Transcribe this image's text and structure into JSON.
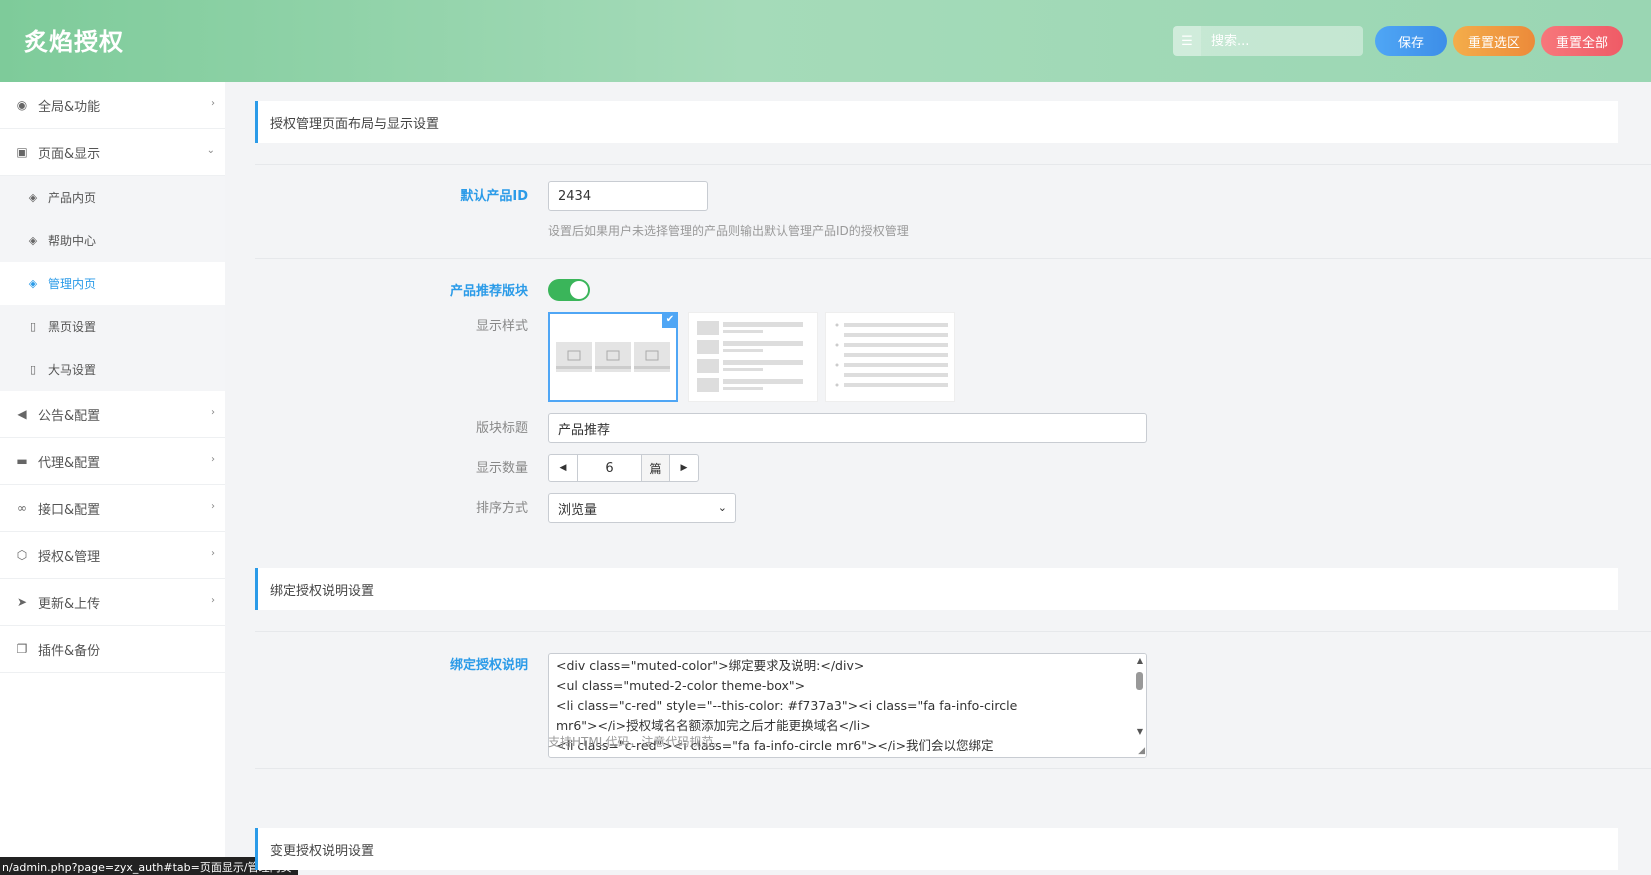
{
  "header": {
    "brand": "炙焰授权",
    "search_placeholder": "搜索...",
    "buttons": {
      "save": "保存",
      "reset_section": "重置选区",
      "reset_all": "重置全部"
    }
  },
  "sidebar": {
    "items": [
      {
        "label": "全局&功能",
        "icon": "circle-dot-icon",
        "arrow": "›"
      },
      {
        "label": "页面&显示",
        "icon": "calendar-icon",
        "arrow": "⌄"
      },
      {
        "label": "公告&配置",
        "icon": "megaphone-icon",
        "arrow": "›"
      },
      {
        "label": "代理&配置",
        "icon": "credit-card-icon",
        "arrow": "›"
      },
      {
        "label": "接口&配置",
        "icon": "link-icon",
        "arrow": "›"
      },
      {
        "label": "授权&管理",
        "icon": "hexagon-icon",
        "arrow": "›"
      },
      {
        "label": "更新&上传",
        "icon": "paper-plane-icon",
        "arrow": "›"
      },
      {
        "label": "插件&备份",
        "icon": "copy-icon",
        "arrow": ""
      }
    ],
    "sub_items": [
      {
        "label": "产品内页",
        "icon": "cube-icon"
      },
      {
        "label": "帮助中心",
        "icon": "cube-icon"
      },
      {
        "label": "管理内页",
        "icon": "cube-icon"
      },
      {
        "label": "黑页设置",
        "icon": "file-icon"
      },
      {
        "label": "大马设置",
        "icon": "file-icon"
      }
    ]
  },
  "status_url": "n/admin.php?page=zyx_auth#tab=页面显示/管理内页",
  "main": {
    "section1_title": "授权管理页面布局与显示设置",
    "default_id": {
      "label": "默认产品ID",
      "value": "2434",
      "help": "设置后如果用户未选择管理的产品则输出默认管理产品ID的授权管理"
    },
    "recommend": {
      "label": "产品推荐版块",
      "enabled": true,
      "style_label": "显示样式",
      "selected_style": 1,
      "title_label": "版块标题",
      "title_value": "产品推荐",
      "count_label": "显示数量",
      "count_value": "6",
      "count_unit": "篇",
      "sort_label": "排序方式",
      "sort_value": "浏览量"
    },
    "section2_title": "绑定授权说明设置",
    "bind_desc": {
      "label": "绑定授权说明",
      "lines": [
        "<div class=\"muted-color\">绑定要求及说明:</div>",
        "               <ul class=\"muted-2-color theme-box\">",
        "                              <li class=\"c-red\" style=\"--this-color: #f737a3\"><i class=\"fa fa-info-circle",
        "mr6\"></i>授权域名名额添加完之后才能更换域名</li>",
        "                              <li class=\"c-red\"><i class=\"fa fa-info-circle mr6\"></i>我们会以您绑定"
      ],
      "help": "支持HTML代码，注意代码规范。"
    },
    "section3_title": "变更授权说明设置"
  },
  "colors": {
    "accent": "#2b9be8",
    "toggle_on": "#3ab55a",
    "header_start": "#7ecb9a",
    "header_end": "#9ad6b3"
  }
}
